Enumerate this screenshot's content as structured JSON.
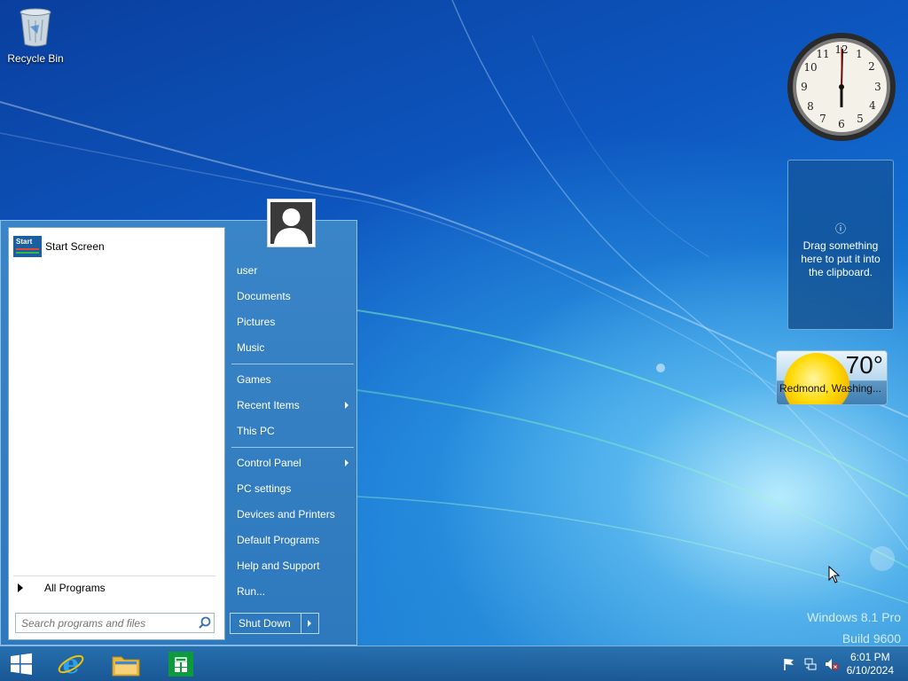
{
  "desktop": {
    "recycle_bin_label": "Recycle Bin",
    "watermark_line1": "Windows 8.1 Pro",
    "watermark_line2": "Build 9600"
  },
  "gadgets": {
    "clock": {
      "hour": 6,
      "minute": 1
    },
    "clipboard": {
      "info_icon": "info-icon",
      "message": "Drag something here to put it into the clipboard."
    },
    "weather": {
      "temperature": "70°",
      "location": "Redmond, Washing..."
    }
  },
  "start_menu": {
    "pinned": [
      {
        "label": "Start Screen",
        "tile_text": "Start"
      }
    ],
    "all_programs_label": "All Programs",
    "search_placeholder": "Search programs and files",
    "right_items": [
      {
        "label": "user"
      },
      {
        "label": "Documents"
      },
      {
        "label": "Pictures"
      },
      {
        "label": "Music"
      },
      {
        "label": "Games"
      },
      {
        "label": "Recent Items",
        "submenu": true
      },
      {
        "label": "This PC"
      },
      {
        "label": "Control Panel",
        "submenu": true
      },
      {
        "label": "PC settings"
      },
      {
        "label": "Devices and Printers"
      },
      {
        "label": "Default Programs"
      },
      {
        "label": "Help and Support"
      },
      {
        "label": "Run..."
      }
    ],
    "shutdown_label": "Shut Down"
  },
  "taskbar": {
    "buttons": [
      "start-button",
      "internet-explorer",
      "file-explorer",
      "store"
    ],
    "tray_icons": [
      "action-center-flag-icon",
      "network-icon",
      "volume-muted-icon"
    ],
    "time": "6:01 PM",
    "date": "6/10/2024"
  },
  "colors": {
    "accent": "#2e78bd",
    "taskbar": "#1f6aa8"
  }
}
